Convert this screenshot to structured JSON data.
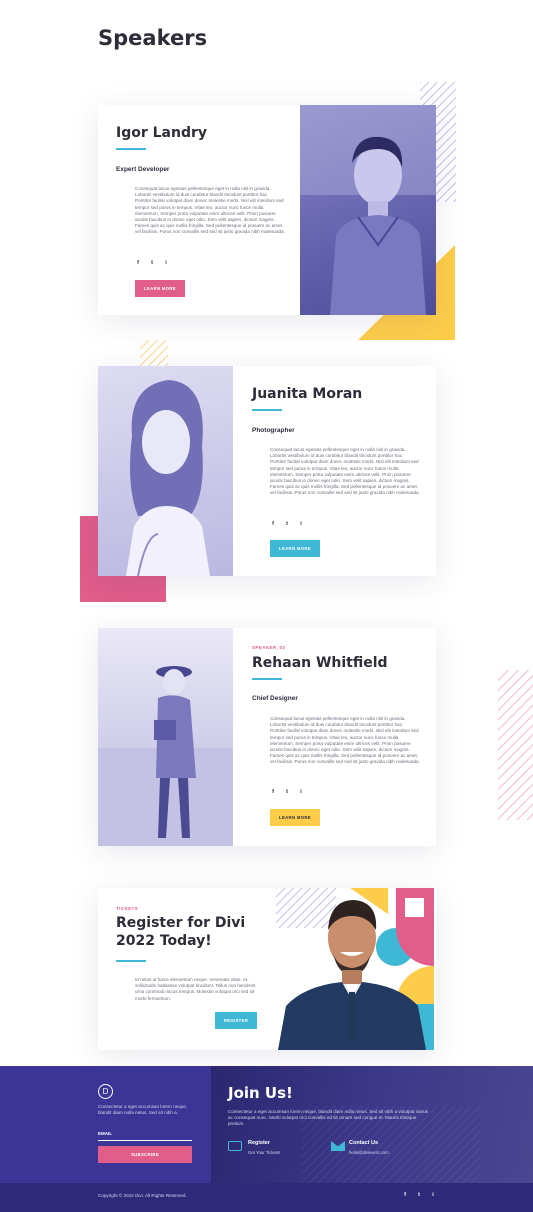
{
  "page": {
    "title": "Speakers"
  },
  "colors": {
    "accent_blue": "#3fb8d6",
    "accent_pink": "#e15d8a",
    "accent_yellow": "#fdcd4a",
    "deep_purple": "#3a338d",
    "photo_tint": "#5f5cb0"
  },
  "speakers": [
    {
      "name": "Igor Landry",
      "role": "Expert Developer",
      "tag": "",
      "bio": "Consequat lacus egestas pellentesque eget in nulla nisl in gravida. Lobortis vestibulum id duis curabitur blandit tincidunt porttitor hac. Porttitor facilisi volutpat diam donec molestie morbi. Nisl elit interdum sed tempor sed purus in tempus. Vitae leo, auctor nunc fusce mulla elementum. Semper porta vulputate enim ultrices velit. Proin posuere iaculis faucibus in donec eget odio. Sem velit sapien, dictum magnis. Fames quis ac quis mollis fringilla. Sed pellentesque id posuere ac amet, vel facilisis. Purus non convallis sed sed sit justo gravida nibh malesuada.",
      "social": [
        "f",
        "t",
        "i"
      ],
      "social_icons": [
        "facebook-icon",
        "twitter-icon",
        "instagram-icon"
      ],
      "button": "LEARN MORE",
      "button_color": "#e15d8a"
    },
    {
      "name": "Juanita Moran",
      "role": "Photographer",
      "tag": "",
      "bio": "Consequat lacus egestas pellentesque eget in nulla nisl in gravida. Lobortis vestibulum id duis curabitur blandit tincidunt porttitor hac. Porttitor facilisi volutpat diam donec molestie morbi. Nisl elit interdum sed tempor sed purus in tempus. Vitae leo, auctor nunc fusce mulla elementum. Semper porta vulputate enim ultrices velit. Proin posuere iaculis faucibus in donec eget odio. Sem velit sapien, dictum magnis. Fames quis ac quis mollis fringilla. Sed pellentesque id posuere ac amet, vel facilisis. Purus non convallis sed sed sit justo gravida nibh malesuada.",
      "social": [
        "f",
        "t",
        "i"
      ],
      "social_icons": [
        "facebook-icon",
        "twitter-icon",
        "instagram-icon"
      ],
      "button": "LEARN MORE",
      "button_color": "#3fb8d6"
    },
    {
      "name": "Rehaan Whitfield",
      "role": "Chief Designer",
      "tag": "SPEAKER_03",
      "bio": "Consequat lacus egestas pellentesque eget in nulla nisl in gravida. Lobortis vestibulum id duis curabitur blandit tincidunt porttitor hac. Porttitor facilisi volutpat diam donec molestie morbi. Nisl elit interdum sed tempor sed purus in tempus. Vitae leo, auctor nunc fusce mulla elementum. Semper porta vulputate enim ultrices velit. Proin posuere iaculis faucibus in donec eget odio. Sem velit sapien, dictum magnis. Fames quis ac quis mollis fringilla. Sed pellentesque id posuere ac amet, vel facilisis. Purus non convallis sed sed sit justo gravida nibh malesuada.",
      "social": [
        "f",
        "t",
        "i"
      ],
      "social_icons": [
        "facebook-icon",
        "twitter-icon",
        "instagram-icon"
      ],
      "button": "LEARN MORE",
      "button_color": "#fdcd4a"
    }
  ],
  "tickets": {
    "tag": "TICKETS",
    "title_line1": "Register for Divi",
    "title_line2": "2022 Today!",
    "text": "Id netus ut fusce elementum neque. Venenatis vitae, et, sollicitudin habitasse volutpat tincidunt. Tellus non hendrerit urna commodo lacus tempus. Molestie volutpat orci sed sit morbi fermentum.",
    "button": "REGISTER"
  },
  "footer": {
    "logo_letter": "D",
    "newsletter_text": "Consectetur a eget accumsan lorem neque, blandit diam nulla netus. Sed sit nibh a.",
    "email_label": "EMAIL",
    "subscribe_button": "SUBSCRIBE",
    "join_title": "Join Us!",
    "join_text": "Consectetur a eget accumsan lorem neque, blandit diam nulla netus. Sed sit nibh a volutpat varius ac consequat nunc. Morbi volutpat orci convallis ed sit ornare sed congue et. Mauris tristique pretium.",
    "register_title": "Register",
    "register_sub": "Get Your Tickets!",
    "contact_title": "Contact Us",
    "contact_sub": "hello@divievent.com",
    "copyright": "Copyright © 2022 Divi. All Rights Reserved.",
    "social": [
      "f",
      "t",
      "i"
    ]
  }
}
